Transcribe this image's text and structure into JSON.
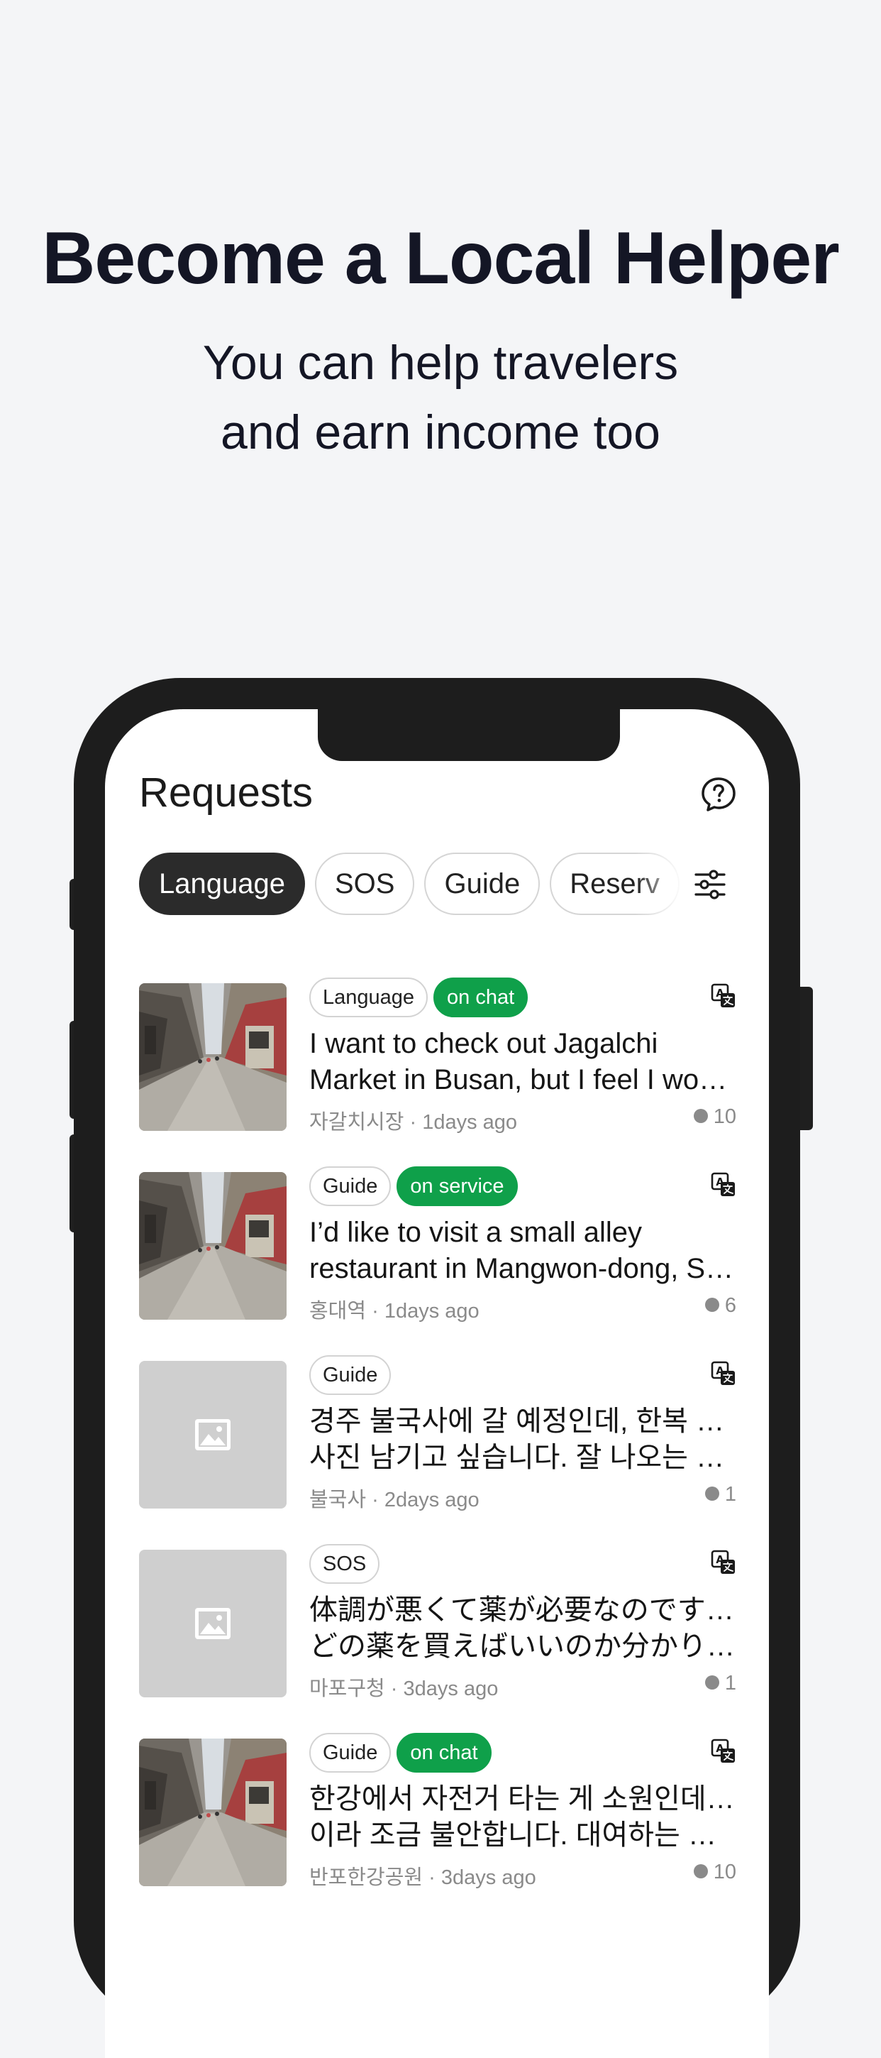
{
  "hero": {
    "title": "Become a Local Helper",
    "subtitle_line1": "You can help travelers",
    "subtitle_line2": "and earn income too"
  },
  "app": {
    "title": "Requests",
    "help_icon": "question-bubble-icon",
    "filter_icon": "sliders-icon",
    "chips": [
      "Language",
      "SOS",
      "Guide",
      "Reserv"
    ],
    "active_chip": "Language"
  },
  "requests": [
    {
      "tags": [
        "Language",
        "on chat"
      ],
      "title_line1": "I want to check out Jagalchi",
      "title_line2": "Market in Busan, but I feel I won’…",
      "location": "자갈치시장",
      "time": "1days ago",
      "comments": "10",
      "image": "street-photo"
    },
    {
      "tags": [
        "Guide",
        "on service"
      ],
      "title_line1": "I’d like to visit a small alley",
      "title_line2": "restaurant in Mangwon-dong, Se…",
      "location": "홍대역",
      "time": "1days ago",
      "comments": "6",
      "image": "street-photo"
    },
    {
      "tags": [
        "Guide"
      ],
      "title_line1": "경주 불국사에 갈 예정인데, 한복 입고",
      "title_line2": "사진 남기고 싶습니다. 잘 나오는 포…",
      "location": "불국사",
      "time": "2days ago",
      "comments": "1",
      "image": "placeholder"
    },
    {
      "tags": [
        "SOS"
      ],
      "title_line1": "体調が悪くて薬が必要なのですが、",
      "title_line2": "どの薬を買えばいいのか分かりま…",
      "location": "마포구청",
      "time": "3days ago",
      "comments": "1",
      "image": "placeholder"
    },
    {
      "tags": [
        "Guide",
        "on chat"
      ],
      "title_line1": "한강에서 자전거 타는 게 소원인데 처음",
      "title_line2": "이라 조금 불안합니다. 대여하는 거부…",
      "location": "반포한강공원",
      "time": "3days ago",
      "comments": "10",
      "image": "street-photo"
    }
  ],
  "colors": {
    "background": "#f4f5f7",
    "status_green": "#0fa04a",
    "chip_active": "#2b2b2b",
    "phone_frame": "#1d1d1d"
  }
}
